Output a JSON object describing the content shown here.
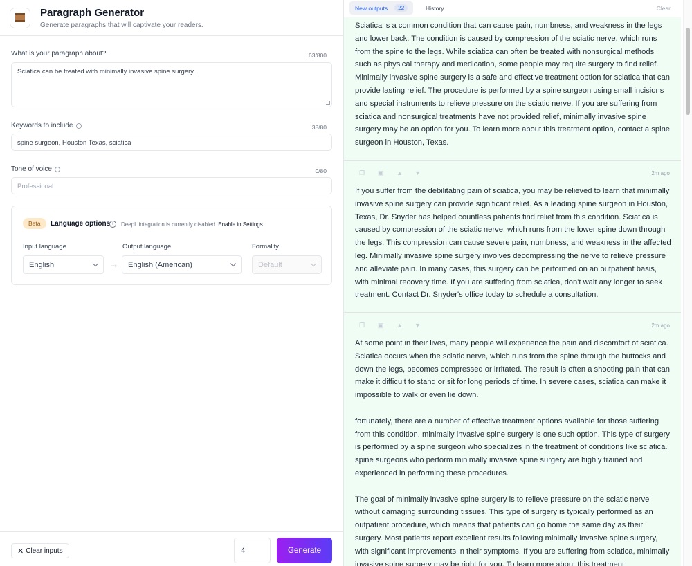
{
  "app": {
    "title": "Paragraph Generator",
    "subtitle": "Generate paragraphs that will captivate your readers.",
    "icon": "paragraph-doc-icon"
  },
  "form": {
    "topic": {
      "label": "What is your paragraph about?",
      "counter": "63/800",
      "value": "Sciatica can be treated with minimally invasive spine surgery."
    },
    "keywords": {
      "label": "Keywords to include",
      "counter": "38/80",
      "value": "spine surgeon, Houston Texas, sciatica"
    },
    "tone": {
      "label": "Tone of voice",
      "counter": "0/80",
      "placeholder": "Professional"
    },
    "language": {
      "badge": "Beta",
      "title": "Language options",
      "note_prefix": "DeepL integration is currently disabled.",
      "note_link": "Enable in Settings.",
      "input_label": "Input language",
      "input_value": "English",
      "output_label": "Output language",
      "output_value": "English (American)",
      "formality_label": "Formality",
      "formality_value": "Default"
    }
  },
  "footer": {
    "clear_label": "Clear inputs",
    "count_value": "4",
    "generate_label": "Generate"
  },
  "tabs": {
    "new_label": "New outputs",
    "new_count": "22",
    "history_label": "History",
    "clear_label": "Clear"
  },
  "outputs": [
    {
      "time": "",
      "paragraphs": [
        "Sciatica is a common condition that can cause pain, numbness, and weakness in the legs and lower back. The condition is caused by compression of the sciatic nerve, which runs from the spine to the legs. While sciatica can often be treated with nonsurgical methods such as physical therapy and medication, some people may require surgery to find relief. Minimally invasive spine surgery is a safe and effective treatment option for sciatica that can provide lasting relief. The procedure is performed by a spine surgeon using small incisions and special instruments to relieve pressure on the sciatic nerve. If you are suffering from sciatica and nonsurgical treatments have not provided relief, minimally invasive spine surgery may be an option for you. To learn more about this treatment option, contact a spine surgeon in Houston, Texas."
      ]
    },
    {
      "time": "2m ago",
      "paragraphs": [
        "If you suffer from the debilitating pain of sciatica, you may be relieved to learn that minimally invasive spine surgery can provide significant relief. As a leading spine surgeon in Houston, Texas, Dr. Snyder has helped countless patients find relief from this condition. Sciatica is caused by compression of the sciatic nerve, which runs from the lower spine down through the legs. This compression can cause severe pain, numbness, and weakness in the affected leg. Minimally invasive spine surgery involves decompressing the nerve to relieve pressure and alleviate pain. In many cases, this surgery can be performed on an outpatient basis, with minimal recovery time. If you are suffering from sciatica, don't wait any longer to seek treatment. Contact Dr. Snyder's office today to schedule a consultation."
      ]
    },
    {
      "time": "2m ago",
      "paragraphs": [
        "At some point in their lives, many people will experience the pain and discomfort of sciatica. Sciatica occurs when the sciatic nerve, which runs from the spine through the buttocks and down the legs, becomes compressed or irritated. The result is often a shooting pain that can make it difficult to stand or sit for long periods of time. In severe cases, sciatica can make it impossible to walk or even lie down.",
        " fortunately, there are a number of effective treatment options available for those suffering from this condition. minimally invasive spine surgery is one such option. This type of surgery is performed by a spine surgeon who specializes in the treatment of conditions like sciatica. spine surgeons who perform minimally invasive spine surgery are highly trained and experienced in performing these procedures.",
        "The goal of minimally invasive spine surgery is to relieve pressure on the sciatic nerve without damaging surrounding tissues. This type of surgery is typically performed as an outpatient procedure, which means that patients can go home the same day as their surgery. Most patients report excellent results following minimally invasive spine surgery, with significant improvements in their symptoms. If you are suffering from sciatica, minimally invasive spine surgery may be right for you. To learn more about this treatment"
      ]
    }
  ]
}
